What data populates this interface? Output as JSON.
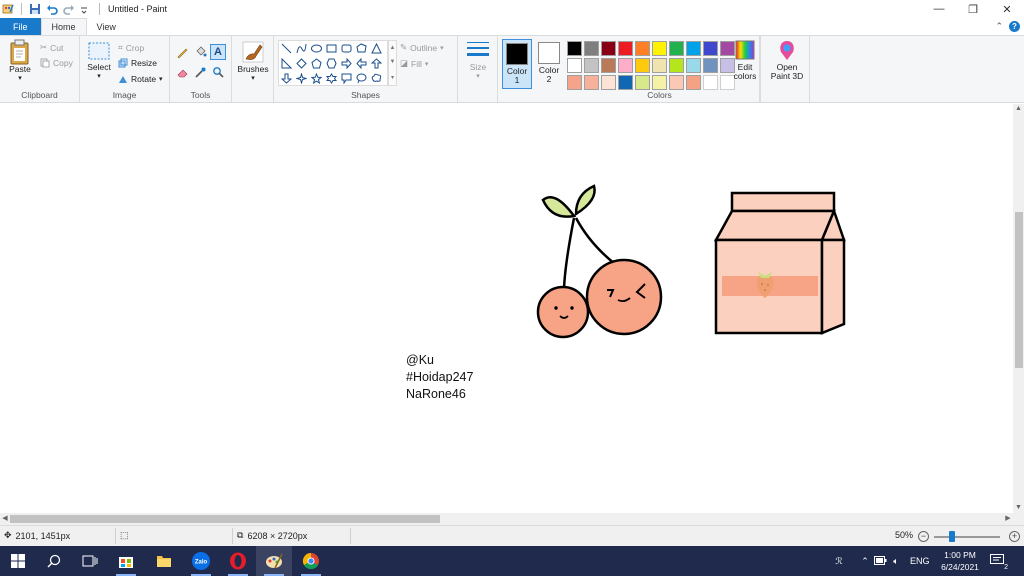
{
  "window": {
    "title": "Untitled - Paint",
    "controls": {
      "minimize": "—",
      "restore": "❐",
      "close": "✕"
    }
  },
  "tabs": {
    "file": "File",
    "home": "Home",
    "view": "View",
    "collapse_glyph": "⌃",
    "help_glyph": "?"
  },
  "ribbon": {
    "clipboard": {
      "label": "Clipboard",
      "paste": "Paste",
      "cut": "Cut",
      "copy": "Copy"
    },
    "image": {
      "label": "Image",
      "select": "Select",
      "crop": "Crop",
      "resize": "Resize",
      "rotate": "Rotate"
    },
    "tools": {
      "label": "Tools"
    },
    "brushes": {
      "label": "Brushes"
    },
    "shapes": {
      "label": "Shapes",
      "outline": "Outline",
      "fill": "Fill"
    },
    "size": {
      "label": "Size"
    },
    "color1": {
      "label": "Color",
      "num": "1",
      "color": "#000000"
    },
    "color2": {
      "label": "Color",
      "num": "2",
      "color": "#ffffff"
    },
    "colors": {
      "label": "Colors",
      "palette": [
        "#000000",
        "#7f7f7f",
        "#880015",
        "#ed1c24",
        "#ff7f27",
        "#fff200",
        "#22b14c",
        "#00a2e8",
        "#3f48cc",
        "#a349a4",
        "#ffffff",
        "#c3c3c3",
        "#b97a57",
        "#ffaec9",
        "#ffc90e",
        "#efe4b0",
        "#b5e61d",
        "#99d9ea",
        "#7092be",
        "#c8bfe7",
        "#f5a38a",
        "#f7b09a",
        "#fde3d6",
        "#1167b1",
        "#d9e88a",
        "#f4f2a6",
        "#f9c9b6",
        "#f4a283",
        "",
        ""
      ]
    },
    "edit_colors": {
      "line1": "Edit",
      "line2": "colors"
    },
    "paint3d": {
      "line1": "Open",
      "line2": "Paint 3D"
    }
  },
  "canvas": {
    "text_lines": [
      "@Ku",
      "#Hoidap247",
      "NaRone46"
    ],
    "drawing_colors": {
      "peach": "#f7a386",
      "pink_box": "#fcd0bf",
      "leaf": "#d6e89a",
      "stripe": "#f7a386",
      "berry": "#f0a070",
      "outline": "#000000"
    }
  },
  "status": {
    "cursor_pos": "2101, 1451px",
    "canvas_size": "6208 × 2720px",
    "zoom": "50%"
  },
  "taskbar": {
    "apps": [
      "start-icon",
      "search-icon",
      "task-view-icon",
      "store-icon",
      "file-explorer-icon",
      "zalo-icon",
      "opera-icon",
      "paint-icon",
      "chrome-icon"
    ],
    "zalo_text": "Zalo",
    "lang": "ENG",
    "time": "1:00 PM",
    "date": "6/24/2021",
    "notif_count": "2",
    "user_glyph": "ℛ"
  }
}
